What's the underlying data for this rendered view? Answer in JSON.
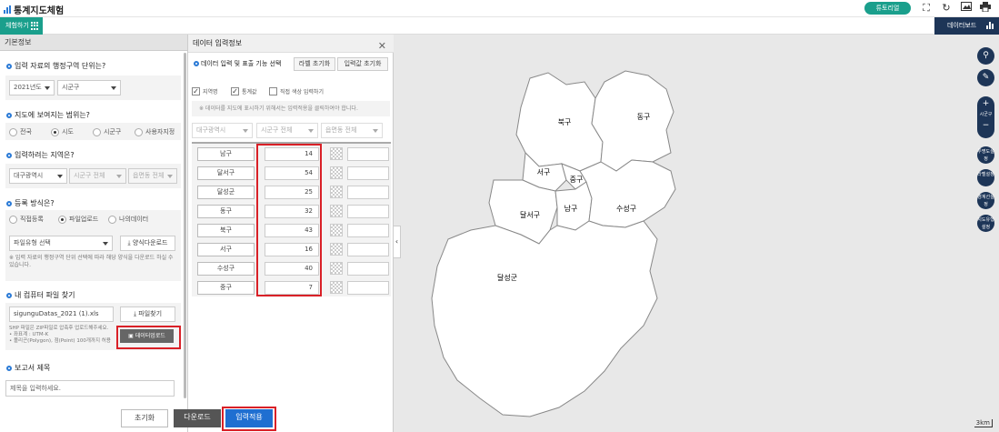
{
  "app": {
    "title": "통계지도체험"
  },
  "topbar": {
    "tutorial_label": "튜토리얼",
    "icons": [
      "fullscreen-icon",
      "refresh-icon",
      "image-icon",
      "print-icon"
    ]
  },
  "subbar": {
    "experience_label": "체험하기",
    "dashboard_label": "데이터보드"
  },
  "left": {
    "title": "기본정보",
    "q1": "입력 자료의 행정구역 단위는?",
    "year_select": "2021년도",
    "level_select": "시군구",
    "q2": "지도에 보여지는 범위는?",
    "range_options": [
      "전국",
      "시도",
      "시군구",
      "사용자지정"
    ],
    "range_selected": "시도",
    "q3": "입력하려는 지역은?",
    "region_sido": "대구광역시",
    "region_sigungu": "시군구 전체",
    "region_emd": "읍면동 전체",
    "q4": "등록 방식은?",
    "method_options": [
      "직접등록",
      "파일업로드",
      "나의데이터"
    ],
    "method_selected": "파일업로드",
    "file_type": "파일유형 선택",
    "template_download": "양식다운로드",
    "note1": "※ 입력 자료의 행정구역 단위 선택에 따라 해당 양식을 다운로드 하실 수 있습니다.",
    "q5": "내 컴퓨터 파일 찾기",
    "file_name": "sigunguDatas_2021 (1).xls",
    "file_find": "파일찾기",
    "shp_note": "SHP 파일은 ZIP파일로 압축후 업로드해주세요.\n• 좌표계 : UTM-K\n• 폴리곤(Polygon), 점(Point) 100개까지 허용",
    "data_upload": "데이터업로드",
    "q6": "보고서 제목",
    "report_placeholder": "제목을 입력하세요."
  },
  "mid": {
    "title": "데이터 입력정보",
    "section_label": "데이터 입력 및 표출 기능 선택",
    "label_reset": "라벨 초기화",
    "input_reset": "입력값 초기화",
    "chk_region": "지역명",
    "chk_stat": "통계값",
    "chk_color": "직접 색상 입력하기",
    "hint": "※ 데이터를 지도에 표시하기 위해서는 입력적용을 클릭하여야 합니다.",
    "filter_sido": "대구광역시",
    "filter_sigungu": "시군구 전체",
    "filter_emd": "읍면동 전체",
    "rows": [
      {
        "name": "남구",
        "value": "14"
      },
      {
        "name": "달서구",
        "value": "54"
      },
      {
        "name": "달성군",
        "value": "25"
      },
      {
        "name": "동구",
        "value": "32"
      },
      {
        "name": "북구",
        "value": "43"
      },
      {
        "name": "서구",
        "value": "16"
      },
      {
        "name": "수성구",
        "value": "40"
      },
      {
        "name": "중구",
        "value": "7"
      }
    ]
  },
  "bottom": {
    "reset": "초기화",
    "download": "다운로드",
    "apply": "입력적용"
  },
  "map": {
    "labels": {
      "bukgu": "북구",
      "donggu": "동구",
      "seogu": "서구",
      "junggu": "중구",
      "dalseogu": "달서구",
      "namgu": "남구",
      "suseonggu": "수성구",
      "dalseonggun": "달성군"
    },
    "scale": "3km",
    "side_buttons": {
      "zoom_in": "+",
      "level": "시군구",
      "zoom_out": "−",
      "bubble": "투명도설정",
      "label": "라벨설정",
      "boundary": "경계선설정",
      "map_type": "지도유형설정"
    }
  },
  "colors": {
    "accent_teal": "#1a9f8c",
    "navy": "#1d3557",
    "apply_blue": "#1f6fd1",
    "highlight_red": "#d92027"
  }
}
